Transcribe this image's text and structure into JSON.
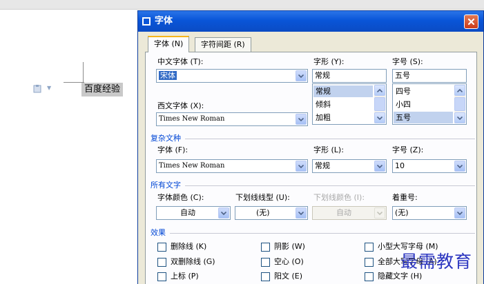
{
  "document": {
    "text": "百度经验"
  },
  "dialog": {
    "title": "字体",
    "tabs": [
      {
        "label": "字体 (N)"
      },
      {
        "label": "字符间距 (R)"
      }
    ],
    "chinese_font": {
      "label": "中文字体 (T):",
      "value": "宋体"
    },
    "style": {
      "label": "字形 (Y):",
      "value": "常规",
      "options": [
        "常规",
        "倾斜",
        "加粗"
      ],
      "selected": "常规"
    },
    "size": {
      "label": "字号 (S):",
      "value": "五号",
      "options": [
        "四号",
        "小四",
        "五号"
      ],
      "selected": "五号"
    },
    "western_font": {
      "label": "西文字体 (X):",
      "value": "Times New Roman"
    },
    "complex": {
      "section": "复杂文种",
      "font_label": "字体 (F):",
      "font_value": "Times New Roman",
      "style_label": "字形 (L):",
      "style_value": "常规",
      "size_label": "字号 (Z):",
      "size_value": "10"
    },
    "all_text": {
      "section": "所有文字",
      "color_label": "字体颜色 (C):",
      "color_value": "自动",
      "underline_label": "下划线线型 (U):",
      "underline_value": "(无)",
      "underline_color_label": "下划线颜色 (I):",
      "underline_color_value": "自动",
      "emphasis_label": "着重号:",
      "emphasis_value": "(无)"
    },
    "effects": {
      "section": "效果",
      "checkboxes": [
        "删除线 (K)",
        "阴影 (W)",
        "小型大写字母 (M)",
        "双删除线 (G)",
        "空心 (O)",
        "全部大写字母 (A)",
        "上标 (P)",
        "阳文 (E)",
        "隐藏文字 (H)"
      ]
    }
  },
  "watermark": "最需教育",
  "colors": {
    "title_bar": "#0a55d8",
    "dialog_bg": "#ece9d8",
    "section_text": "#0046d5",
    "selection": "#316ac5",
    "close_button": "#d2461f",
    "watermark": "#2b35c0"
  }
}
